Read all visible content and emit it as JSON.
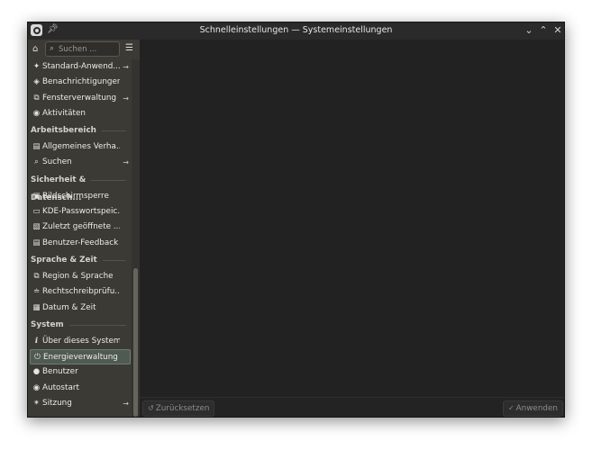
{
  "window": {
    "title": "Schnelleinstellungen — Systemeinstellungen"
  },
  "sidebar": {
    "search_placeholder": "Suchen ...",
    "groups": [
      {
        "heading": "",
        "items": [
          {
            "label": "Standard-Anwend...",
            "icon": "star-icon",
            "arrow": true
          },
          {
            "label": "Benachrichtigungen",
            "icon": "notification-icon",
            "arrow": false
          },
          {
            "label": "Fensterverwaltung",
            "icon": "windows-icon",
            "arrow": true
          },
          {
            "label": "Aktivitäten",
            "icon": "activities-icon",
            "arrow": false
          }
        ]
      },
      {
        "heading": "Arbeitsbereich",
        "items": [
          {
            "label": "Allgemeines Verha...",
            "icon": "general-behavior-icon",
            "arrow": false
          },
          {
            "label": "Suchen",
            "icon": "search-icon",
            "arrow": true
          }
        ]
      },
      {
        "heading": "Sicherheit & Datensch...",
        "items": [
          {
            "label": "Bildschirmsperre",
            "icon": "lock-icon",
            "arrow": false
          },
          {
            "label": "KDE-Passwortspeic...",
            "icon": "wallet-icon",
            "arrow": false
          },
          {
            "label": "Zuletzt geöffnete ...",
            "icon": "recent-files-icon",
            "arrow": false
          },
          {
            "label": "Benutzer-Feedback",
            "icon": "feedback-icon",
            "arrow": false
          }
        ]
      },
      {
        "heading": "Sprache & Zeit",
        "items": [
          {
            "label": "Region & Sprache",
            "icon": "region-icon",
            "arrow": false
          },
          {
            "label": "Rechtschreibprüfu...",
            "icon": "spellcheck-icon",
            "arrow": false
          },
          {
            "label": "Datum & Zeit",
            "icon": "calendar-icon",
            "arrow": false
          }
        ]
      },
      {
        "heading": "System",
        "items": [
          {
            "label": "Über dieses System",
            "icon": "info-icon",
            "arrow": false
          },
          {
            "label": "Energieverwaltung",
            "icon": "power-icon",
            "arrow": false,
            "active": true
          },
          {
            "label": "Benutzer",
            "icon": "user-icon",
            "arrow": false
          },
          {
            "label": "Autostart",
            "icon": "autostart-icon",
            "arrow": false
          },
          {
            "label": "Sitzung",
            "icon": "session-icon",
            "arrow": true
          }
        ]
      }
    ]
  },
  "footer": {
    "reset_label": "Zurücksetzen",
    "apply_label": "Anwenden"
  },
  "colors": {
    "accent": "#4f5a52",
    "sidebar_bg": "#3c3a35",
    "content_bg": "#222222"
  }
}
